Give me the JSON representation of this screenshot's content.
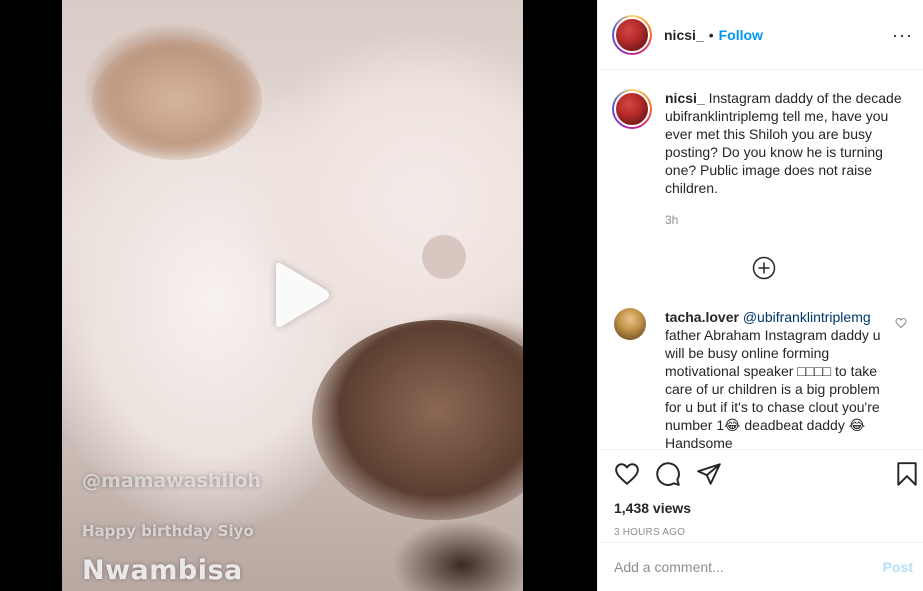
{
  "media": {
    "overlay_text_1": "@mamawashiloh",
    "overlay_text_2": "Happy birthday Siyo",
    "overlay_text_3": "Nwambisa",
    "play_icon": "play-icon"
  },
  "header": {
    "username": "nicsi_",
    "separator": "•",
    "follow_label": "Follow",
    "more_icon": "more-options-icon",
    "more_label": "···"
  },
  "caption": {
    "username": "nicsi_",
    "text": "Instagram daddy of the decade ubifranklintriplemg tell me, have you ever met this Shiloh you are busy posting? Do you know he is turning one? Public image does not raise children.",
    "time": "3h"
  },
  "load_more_icon": "plus-circle-icon",
  "comments": [
    {
      "username": "tacha.lover",
      "mention": "@ubifranklintriplemg",
      "text": "father Abraham Instagram daddy u will be busy online forming motivational speaker □□□□ to take care of ur children is a big problem for u but if it's to chase clout you're number 1😂 deadbeat daddy 😂 Handsome"
    }
  ],
  "actions": {
    "like_icon": "heart-icon",
    "comment_icon": "comment-icon",
    "share_icon": "share-icon",
    "save_icon": "bookmark-icon",
    "views": "1,438 views",
    "time_ago": "3 HOURS AGO"
  },
  "add_comment": {
    "placeholder": "Add a comment...",
    "post_label": "Post"
  },
  "colors": {
    "accent": "#0095f6",
    "post_disabled": "#b2dffc",
    "secondary_text": "#8e8e8e",
    "border": "#efefef"
  }
}
